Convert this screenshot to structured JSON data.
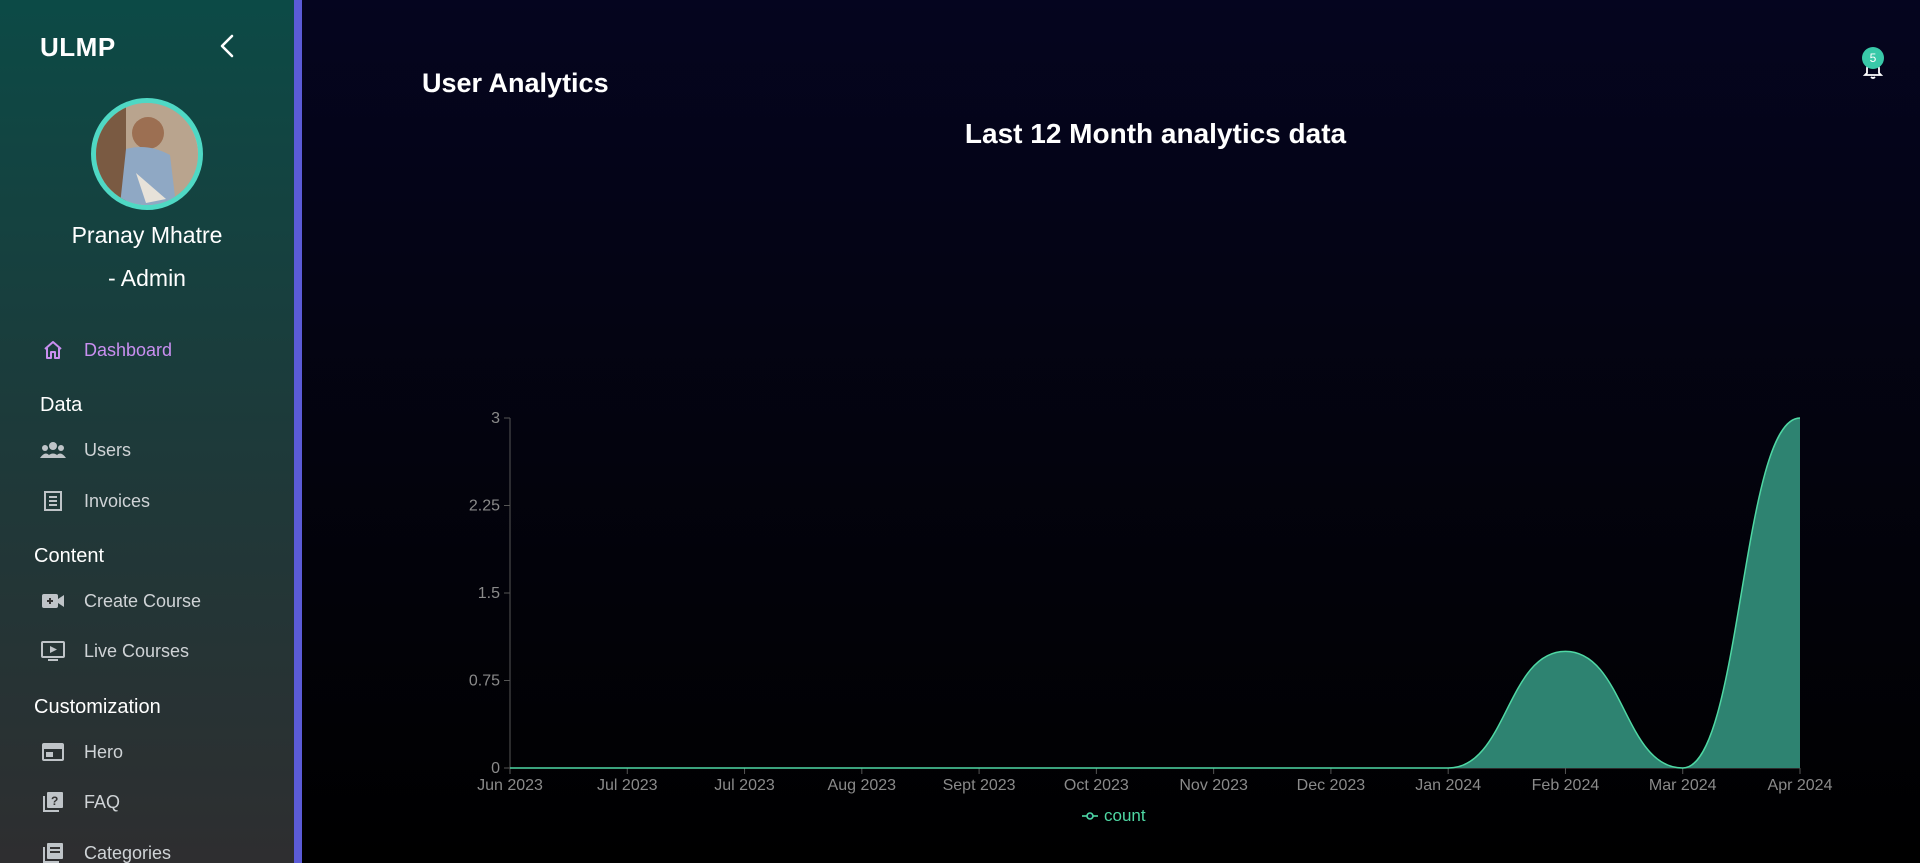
{
  "sidebar": {
    "brand": "ULMP",
    "user_name": "Pranay Mhatre",
    "user_role": "- Admin",
    "dashboard_label": "Dashboard",
    "sections": {
      "data": "Data",
      "content": "Content",
      "customization": "Customization"
    },
    "items": {
      "users": "Users",
      "invoices": "Invoices",
      "create_course": "Create Course",
      "live_courses": "Live Courses",
      "hero": "Hero",
      "faq": "FAQ",
      "categories": "Categories"
    },
    "active_color": "#c98ff0",
    "accent_color": "#5b5bd6"
  },
  "header": {
    "page_title": "User Analytics",
    "notification_count": "5"
  },
  "chart_data": {
    "type": "area",
    "title": "Last 12 Month analytics data",
    "categories": [
      "Jun 2023",
      "Jul 2023",
      "Jul 2023",
      "Aug 2023",
      "Sept 2023",
      "Oct 2023",
      "Nov 2023",
      "Dec 2023",
      "Jan 2024",
      "Feb 2024",
      "Mar 2024",
      "Apr 2024"
    ],
    "series": [
      {
        "name": "count",
        "values": [
          0,
          0,
          0,
          0,
          0,
          0,
          0,
          0,
          0,
          1,
          0,
          3
        ]
      }
    ],
    "yticks": [
      "0",
      "0.75",
      "1.5",
      "2.25",
      "3"
    ],
    "ylim": [
      0,
      3
    ],
    "legend_position": "bottom",
    "color": "#2e8371",
    "stroke_color": "#4fd8a4"
  }
}
